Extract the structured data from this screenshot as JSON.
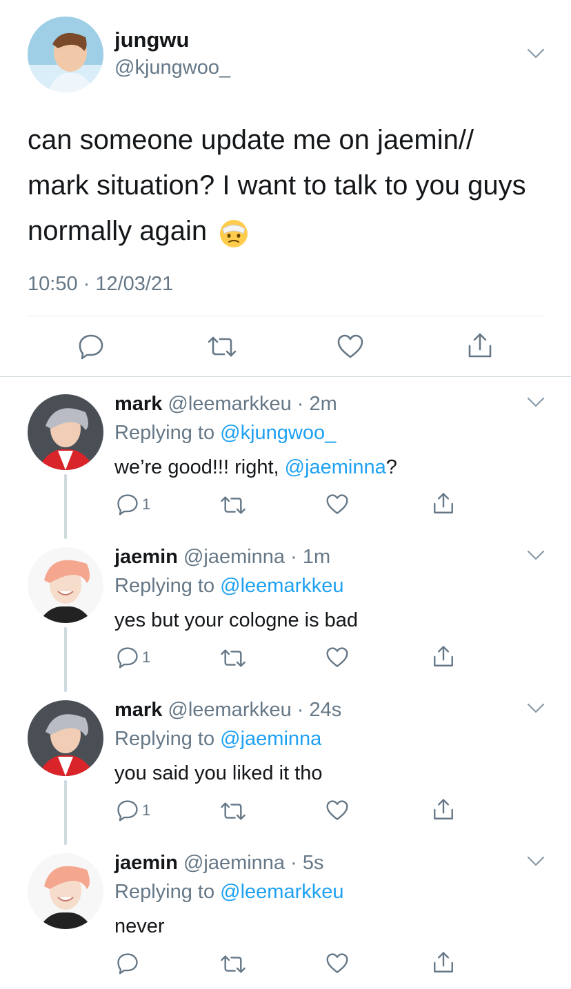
{
  "main_tweet": {
    "display_name": "jungwu",
    "handle": "@kjungwoo_",
    "text": "can someone update me on jaemin// mark situation? I want to talk to you guys normally again",
    "emoji": "🤕",
    "timestamp": "10:50 · 12/03/21",
    "avatar_icon": "profile-photo"
  },
  "replies": [
    {
      "display_name": "mark",
      "handle_time": "@leemarkkeu · 2m",
      "replying_prefix": "Replying to",
      "replying_to": "@kjungwoo_",
      "text_before": "we’re good!!! right, ",
      "mention": "@jaeminna",
      "text_after": "?",
      "reply_count": "1"
    },
    {
      "display_name": "jaemin",
      "handle_time": "@jaeminna · 1m",
      "replying_prefix": "Replying to",
      "replying_to": "@leemarkkeu",
      "text": "yes but your cologne is bad",
      "reply_count": "1"
    },
    {
      "display_name": "mark",
      "handle_time": "@leemarkkeu · 24s",
      "replying_prefix": "Replying to",
      "replying_to": "@jaeminna",
      "text": "you said you liked it tho",
      "reply_count": "1"
    },
    {
      "display_name": "jaemin",
      "handle_time": "@jaeminna · 5s",
      "replying_prefix": "Replying to",
      "replying_to": "@leemarkkeu",
      "text": "never",
      "reply_count": ""
    }
  ],
  "colors": {
    "text": "#14171a",
    "secondary": "#657786",
    "link": "#1da1f2",
    "divider": "#e1e8ed",
    "thread_line": "#cfd9de"
  },
  "icons": [
    "chevron-down-icon",
    "reply-icon",
    "retweet-icon",
    "like-icon",
    "share-icon"
  ]
}
